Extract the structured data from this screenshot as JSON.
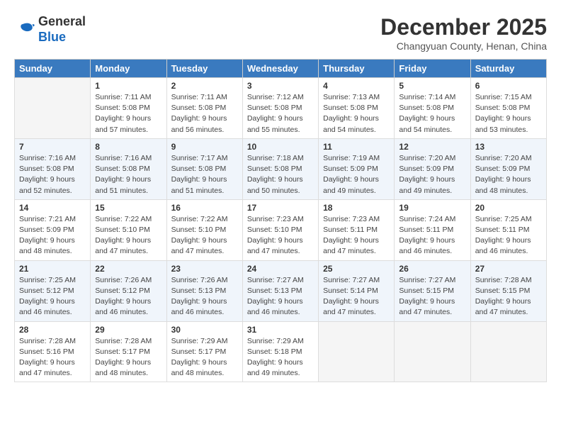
{
  "header": {
    "logo_line1": "General",
    "logo_line2": "Blue",
    "month": "December 2025",
    "location": "Changyuan County, Henan, China"
  },
  "weekdays": [
    "Sunday",
    "Monday",
    "Tuesday",
    "Wednesday",
    "Thursday",
    "Friday",
    "Saturday"
  ],
  "weeks": [
    [
      {
        "day": "",
        "info": ""
      },
      {
        "day": "1",
        "info": "Sunrise: 7:11 AM\nSunset: 5:08 PM\nDaylight: 9 hours\nand 57 minutes."
      },
      {
        "day": "2",
        "info": "Sunrise: 7:11 AM\nSunset: 5:08 PM\nDaylight: 9 hours\nand 56 minutes."
      },
      {
        "day": "3",
        "info": "Sunrise: 7:12 AM\nSunset: 5:08 PM\nDaylight: 9 hours\nand 55 minutes."
      },
      {
        "day": "4",
        "info": "Sunrise: 7:13 AM\nSunset: 5:08 PM\nDaylight: 9 hours\nand 54 minutes."
      },
      {
        "day": "5",
        "info": "Sunrise: 7:14 AM\nSunset: 5:08 PM\nDaylight: 9 hours\nand 54 minutes."
      },
      {
        "day": "6",
        "info": "Sunrise: 7:15 AM\nSunset: 5:08 PM\nDaylight: 9 hours\nand 53 minutes."
      }
    ],
    [
      {
        "day": "7",
        "info": "Sunrise: 7:16 AM\nSunset: 5:08 PM\nDaylight: 9 hours\nand 52 minutes."
      },
      {
        "day": "8",
        "info": "Sunrise: 7:16 AM\nSunset: 5:08 PM\nDaylight: 9 hours\nand 51 minutes."
      },
      {
        "day": "9",
        "info": "Sunrise: 7:17 AM\nSunset: 5:08 PM\nDaylight: 9 hours\nand 51 minutes."
      },
      {
        "day": "10",
        "info": "Sunrise: 7:18 AM\nSunset: 5:08 PM\nDaylight: 9 hours\nand 50 minutes."
      },
      {
        "day": "11",
        "info": "Sunrise: 7:19 AM\nSunset: 5:09 PM\nDaylight: 9 hours\nand 49 minutes."
      },
      {
        "day": "12",
        "info": "Sunrise: 7:20 AM\nSunset: 5:09 PM\nDaylight: 9 hours\nand 49 minutes."
      },
      {
        "day": "13",
        "info": "Sunrise: 7:20 AM\nSunset: 5:09 PM\nDaylight: 9 hours\nand 48 minutes."
      }
    ],
    [
      {
        "day": "14",
        "info": "Sunrise: 7:21 AM\nSunset: 5:09 PM\nDaylight: 9 hours\nand 48 minutes."
      },
      {
        "day": "15",
        "info": "Sunrise: 7:22 AM\nSunset: 5:10 PM\nDaylight: 9 hours\nand 47 minutes."
      },
      {
        "day": "16",
        "info": "Sunrise: 7:22 AM\nSunset: 5:10 PM\nDaylight: 9 hours\nand 47 minutes."
      },
      {
        "day": "17",
        "info": "Sunrise: 7:23 AM\nSunset: 5:10 PM\nDaylight: 9 hours\nand 47 minutes."
      },
      {
        "day": "18",
        "info": "Sunrise: 7:23 AM\nSunset: 5:11 PM\nDaylight: 9 hours\nand 47 minutes."
      },
      {
        "day": "19",
        "info": "Sunrise: 7:24 AM\nSunset: 5:11 PM\nDaylight: 9 hours\nand 46 minutes."
      },
      {
        "day": "20",
        "info": "Sunrise: 7:25 AM\nSunset: 5:11 PM\nDaylight: 9 hours\nand 46 minutes."
      }
    ],
    [
      {
        "day": "21",
        "info": "Sunrise: 7:25 AM\nSunset: 5:12 PM\nDaylight: 9 hours\nand 46 minutes."
      },
      {
        "day": "22",
        "info": "Sunrise: 7:26 AM\nSunset: 5:12 PM\nDaylight: 9 hours\nand 46 minutes."
      },
      {
        "day": "23",
        "info": "Sunrise: 7:26 AM\nSunset: 5:13 PM\nDaylight: 9 hours\nand 46 minutes."
      },
      {
        "day": "24",
        "info": "Sunrise: 7:27 AM\nSunset: 5:13 PM\nDaylight: 9 hours\nand 46 minutes."
      },
      {
        "day": "25",
        "info": "Sunrise: 7:27 AM\nSunset: 5:14 PM\nDaylight: 9 hours\nand 47 minutes."
      },
      {
        "day": "26",
        "info": "Sunrise: 7:27 AM\nSunset: 5:15 PM\nDaylight: 9 hours\nand 47 minutes."
      },
      {
        "day": "27",
        "info": "Sunrise: 7:28 AM\nSunset: 5:15 PM\nDaylight: 9 hours\nand 47 minutes."
      }
    ],
    [
      {
        "day": "28",
        "info": "Sunrise: 7:28 AM\nSunset: 5:16 PM\nDaylight: 9 hours\nand 47 minutes."
      },
      {
        "day": "29",
        "info": "Sunrise: 7:28 AM\nSunset: 5:17 PM\nDaylight: 9 hours\nand 48 minutes."
      },
      {
        "day": "30",
        "info": "Sunrise: 7:29 AM\nSunset: 5:17 PM\nDaylight: 9 hours\nand 48 minutes."
      },
      {
        "day": "31",
        "info": "Sunrise: 7:29 AM\nSunset: 5:18 PM\nDaylight: 9 hours\nand 49 minutes."
      },
      {
        "day": "",
        "info": ""
      },
      {
        "day": "",
        "info": ""
      },
      {
        "day": "",
        "info": ""
      }
    ]
  ]
}
